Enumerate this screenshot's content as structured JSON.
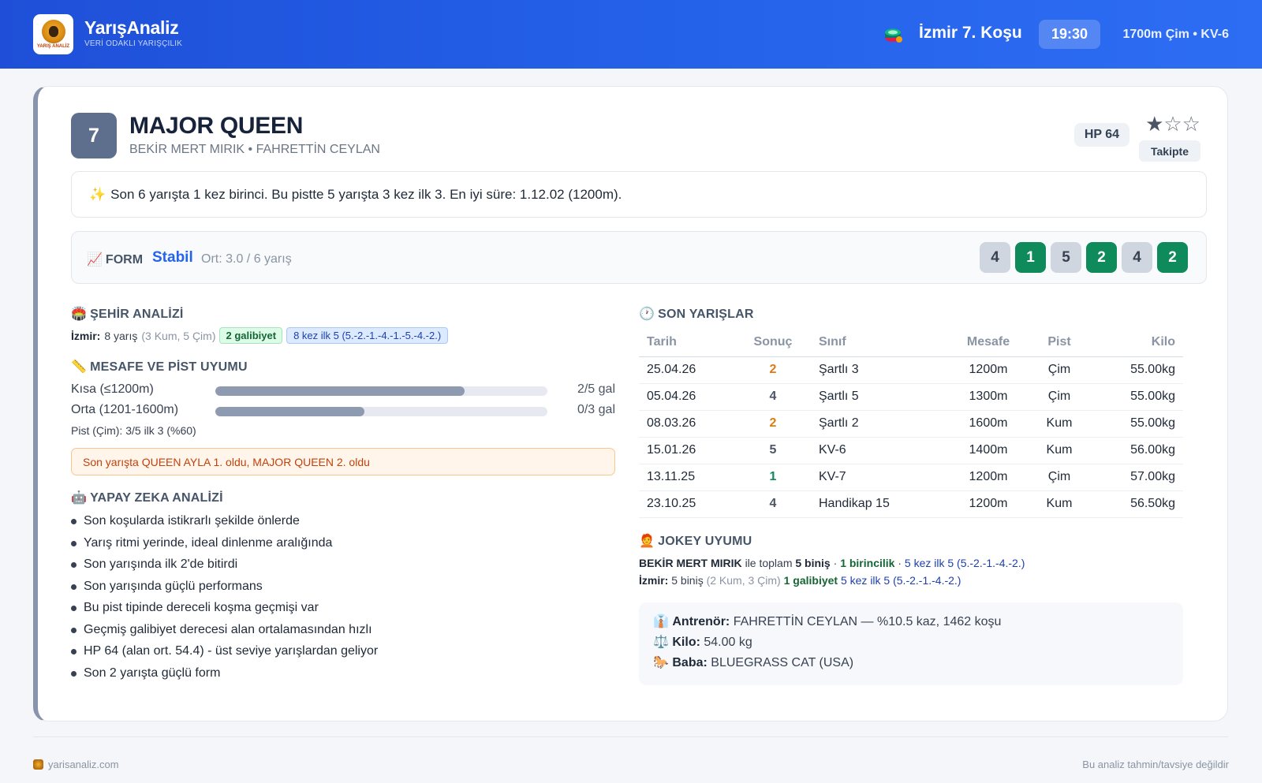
{
  "header": {
    "brand_name": "YarışAnaliz",
    "brand_tagline": "VERİ ODAKLI YARIŞÇILIK",
    "logo_text": "YARIŞ ANALİZ",
    "race_title": "İzmir 7. Koşu",
    "race_time": "19:30",
    "race_info": "1700m Çim • KV-6"
  },
  "horse": {
    "number": "7",
    "name": "MAJOR QUEEN",
    "connections": "BEKİR MERT MIRIK • FAHRETTİN CEYLAN",
    "hp": "HP 64",
    "stars_filled": "★",
    "stars_empty": "☆☆",
    "follow_label": "Takipte"
  },
  "summary": {
    "icon": "✨",
    "text": "Son 6 yarışta 1 kez birinci. Bu pistte 5 yarışta 3 kez ilk 3. En iyi süre: 1.12.02 (1200m)."
  },
  "form": {
    "icon": "📈",
    "label": "FORM",
    "state": "Stabil",
    "average": "Ort: 3.0 / 6 yarış",
    "positions": [
      {
        "value": "4",
        "type": "norm"
      },
      {
        "value": "1",
        "type": "win"
      },
      {
        "value": "5",
        "type": "norm"
      },
      {
        "value": "2",
        "type": "win"
      },
      {
        "value": "4",
        "type": "norm"
      },
      {
        "value": "2",
        "type": "win"
      }
    ]
  },
  "city_analysis": {
    "icon": "🏟️",
    "title": "ŞEHİR ANALİZİ",
    "city": "İzmir:",
    "races": "8 yarış",
    "breakdown": "(3 Kum, 5 Çim)",
    "wins_tag": "2 galibiyet",
    "top5_tag": "8 kez ilk 5 (5.-2.-1.-4.-1.-5.-4.-2.)"
  },
  "distance": {
    "icon": "📏",
    "title": "MESAFE VE PİST UYUMU",
    "rows": [
      {
        "label": "Kısa (≤1200m)",
        "value": "2/5 gal",
        "fill_pct": 75
      },
      {
        "label": "Orta (1201-1600m)",
        "value": "0/3 gal",
        "fill_pct": 45
      }
    ],
    "track_line": "Pist (Çim): 3/5 ilk 3 (%60)"
  },
  "alert": {
    "text": "Son yarışta QUEEN AYLA 1. oldu, MAJOR QUEEN 2. oldu"
  },
  "ai": {
    "icon": "🤖",
    "title": "YAPAY ZEKA ANALİZİ",
    "items": [
      "Son koşularda istikrarlı şekilde önlerde",
      "Yarış ritmi yerinde, ideal dinlenme aralığında",
      "Son yarışında ilk 2'de bitirdi",
      "Son yarışında güçlü performans",
      "Bu pist tipinde dereceli koşma geçmişi var",
      "Geçmiş galibiyet derecesi alan ortalamasından hızlı",
      "HP 64 (alan ort. 54.4) - üst seviye yarışlardan geliyor",
      "Son 2 yarışta güçlü form"
    ]
  },
  "recent": {
    "icon": "🕐",
    "title": "SON YARIŞLAR",
    "headers": [
      "Tarih",
      "Sonuç",
      "Sınıf",
      "Mesafe",
      "Pist",
      "Kilo"
    ],
    "rows": [
      {
        "date": "25.04.26",
        "result": "2",
        "rtype": "place",
        "class": "Şartlı 3",
        "distance": "1200m",
        "track": "Çim",
        "weight": "55.00kg"
      },
      {
        "date": "05.04.26",
        "result": "4",
        "rtype": "norm",
        "class": "Şartlı 5",
        "distance": "1300m",
        "track": "Çim",
        "weight": "55.00kg"
      },
      {
        "date": "08.03.26",
        "result": "2",
        "rtype": "place",
        "class": "Şartlı 2",
        "distance": "1600m",
        "track": "Kum",
        "weight": "55.00kg"
      },
      {
        "date": "15.01.26",
        "result": "5",
        "rtype": "norm",
        "class": "KV-6",
        "distance": "1400m",
        "track": "Kum",
        "weight": "56.00kg"
      },
      {
        "date": "13.11.25",
        "result": "1",
        "rtype": "win",
        "class": "KV-7",
        "distance": "1200m",
        "track": "Çim",
        "weight": "57.00kg"
      },
      {
        "date": "23.10.25",
        "result": "4",
        "rtype": "norm",
        "class": "Handikap 15",
        "distance": "1200m",
        "track": "Kum",
        "weight": "56.50kg"
      }
    ]
  },
  "jockey": {
    "icon": "🧑‍🦰",
    "title": "JOKEY UYUMU",
    "name": "BEKİR MERT MIRIK",
    "with_total": "ile toplam",
    "rides": "5 biniş",
    "sep": "·",
    "firsts": "1 birincilik",
    "top5": "5 kez ilk 5 (5.-2.-1.-4.-2.)",
    "city": "İzmir:",
    "city_rides": "5 biniş",
    "city_breakdown": "(2 Kum, 3 Çim)",
    "city_wins": "1 galibiyet",
    "city_top5": "5 kez ilk 5 (5.-2.-1.-4.-2.)"
  },
  "details": {
    "trainer_icon": "👔",
    "trainer_label": "Antrenör:",
    "trainer_value": "FAHRETTİN CEYLAN — %10.5 kaz, 1462 koşu",
    "weight_icon": "⚖️",
    "weight_label": "Kilo:",
    "weight_value": "54.00 kg",
    "sire_icon": "🐎",
    "sire_label": "Baba:",
    "sire_value": "BLUEGRASS CAT (USA)"
  },
  "footer": {
    "site": "yarisanaliz.com",
    "disclaimer": "Bu analiz tahmin/tavsiye değildir"
  }
}
